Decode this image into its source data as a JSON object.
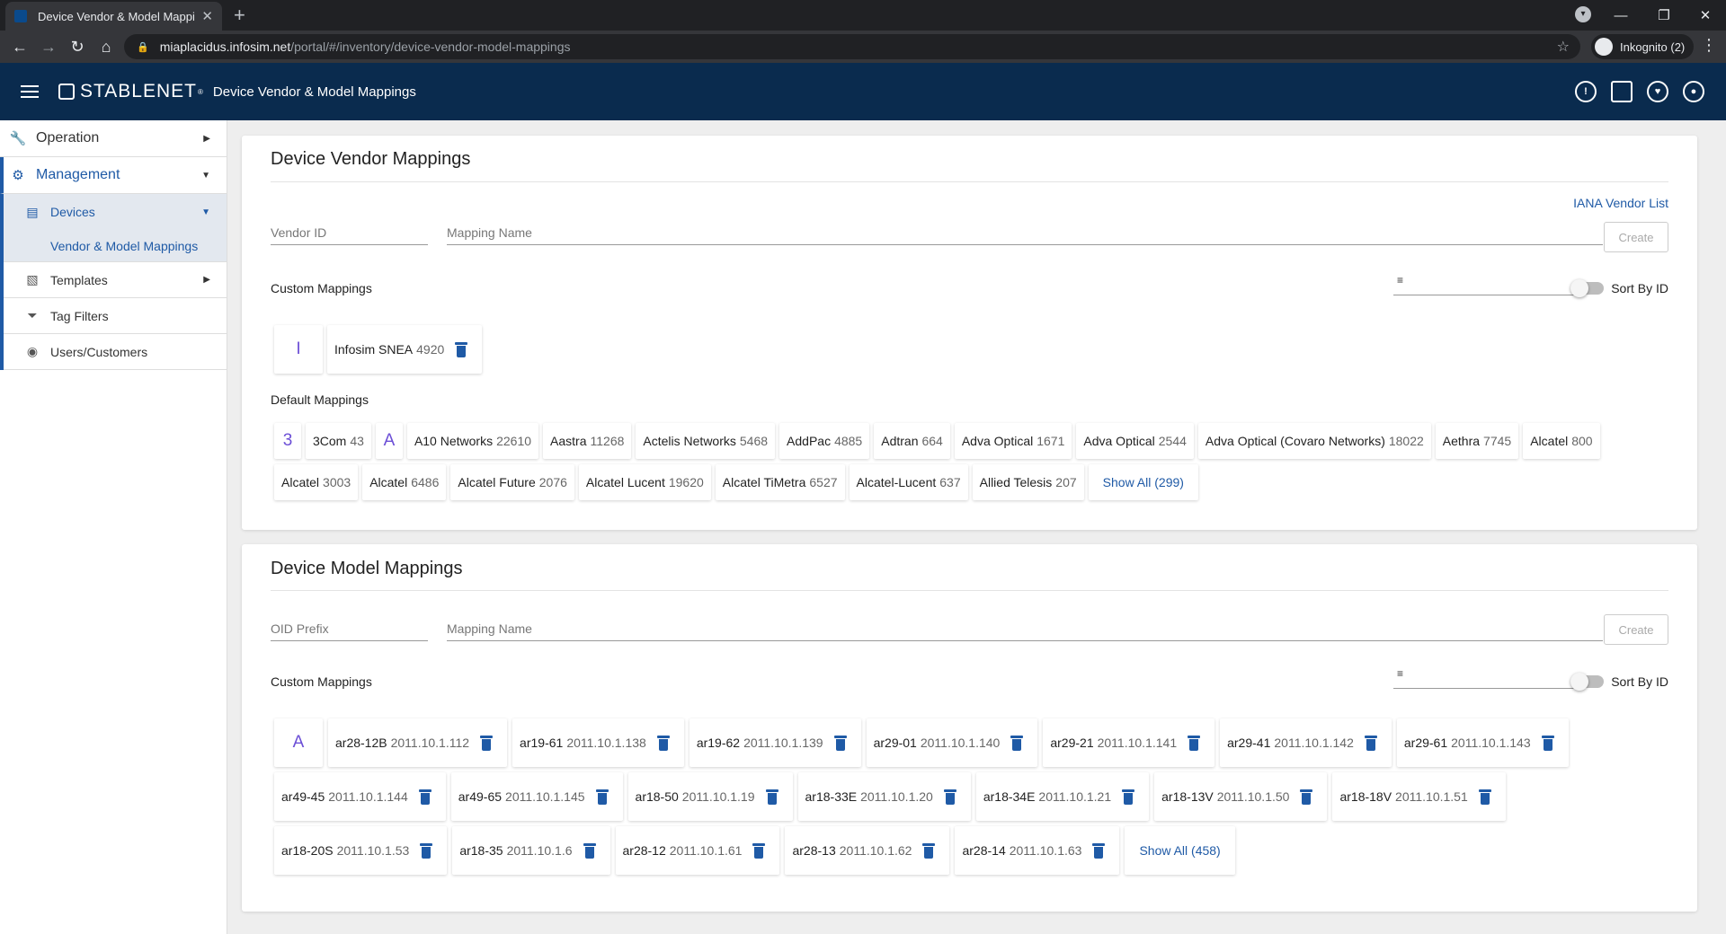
{
  "browser": {
    "tab_title": "Device Vendor & Model Mappings",
    "url_host": "miaplacidus.infosim.net",
    "url_path": "/portal/#/inventory/device-vendor-model-mappings",
    "profile": "Inkognito (2)"
  },
  "header": {
    "brand": "STABLENET",
    "brand_mark": "®",
    "title": "Device Vendor & Model Mappings",
    "icons": [
      "info-icon",
      "bookmark-icon",
      "heart-pulse-icon",
      "account-icon"
    ]
  },
  "sidebar": {
    "operation": "Operation",
    "management": "Management",
    "devices": "Devices",
    "vendor_model": "Vendor & Model Mappings",
    "templates": "Templates",
    "tag_filters": "Tag Filters",
    "users": "Users/Customers"
  },
  "vendor": {
    "title": "Device Vendor Mappings",
    "iana_link": "IANA Vendor List",
    "vendor_id_placeholder": "Vendor ID",
    "mapping_name_placeholder": "Mapping Name",
    "create": "Create",
    "custom_label": "Custom Mappings",
    "sort_label": "Sort By ID",
    "default_label": "Default Mappings",
    "custom_letter": "I",
    "custom": [
      {
        "name": "Infosim SNEA",
        "id": "4920"
      }
    ],
    "default_row1": [
      {
        "letter": "3"
      },
      {
        "name": "3Com",
        "id": "43"
      },
      {
        "letter": "A"
      },
      {
        "name": "A10 Networks",
        "id": "22610"
      },
      {
        "name": "Aastra",
        "id": "11268"
      },
      {
        "name": "Actelis Networks",
        "id": "5468"
      },
      {
        "name": "AddPac",
        "id": "4885"
      },
      {
        "name": "Adtran",
        "id": "664"
      },
      {
        "name": "Adva Optical",
        "id": "1671"
      },
      {
        "name": "Adva Optical",
        "id": "2544"
      },
      {
        "name": "Adva Optical (Covaro Networks)",
        "id": "18022"
      },
      {
        "name": "Aethra",
        "id": "7745"
      },
      {
        "name": "Alcatel",
        "id": "800"
      },
      {
        "name": "Alcatel",
        "id": "3003"
      }
    ],
    "default_row2": [
      {
        "name": "Alcatel",
        "id": "6486"
      },
      {
        "name": "Alcatel Future",
        "id": "2076"
      },
      {
        "name": "Alcatel Lucent",
        "id": "19620"
      },
      {
        "name": "Alcatel TiMetra",
        "id": "6527"
      },
      {
        "name": "Alcatel-Lucent",
        "id": "637"
      },
      {
        "name": "Allied Telesis",
        "id": "207"
      }
    ],
    "show_all": "Show All (299)"
  },
  "model": {
    "title": "Device Model Mappings",
    "oid_placeholder": "OID Prefix",
    "mapping_name_placeholder": "Mapping Name",
    "create": "Create",
    "custom_label": "Custom Mappings",
    "sort_label": "Sort By ID",
    "letter": "A",
    "items": [
      {
        "name": "ar28-12B",
        "id": "2011.10.1.112"
      },
      {
        "name": "ar19-61",
        "id": "2011.10.1.138"
      },
      {
        "name": "ar19-62",
        "id": "2011.10.1.139"
      },
      {
        "name": "ar29-01",
        "id": "2011.10.1.140"
      },
      {
        "name": "ar29-21",
        "id": "2011.10.1.141"
      },
      {
        "name": "ar29-41",
        "id": "2011.10.1.142"
      },
      {
        "name": "ar29-61",
        "id": "2011.10.1.143"
      },
      {
        "name": "ar49-45",
        "id": "2011.10.1.144"
      },
      {
        "name": "ar49-65",
        "id": "2011.10.1.145"
      },
      {
        "name": "ar18-50",
        "id": "2011.10.1.19"
      },
      {
        "name": "ar18-33E",
        "id": "2011.10.1.20"
      },
      {
        "name": "ar18-34E",
        "id": "2011.10.1.21"
      },
      {
        "name": "ar18-13V",
        "id": "2011.10.1.50"
      },
      {
        "name": "ar18-18V",
        "id": "2011.10.1.51"
      },
      {
        "name": "ar18-20S",
        "id": "2011.10.1.53"
      },
      {
        "name": "ar18-35",
        "id": "2011.10.1.6"
      },
      {
        "name": "ar28-12",
        "id": "2011.10.1.61"
      },
      {
        "name": "ar28-13",
        "id": "2011.10.1.62"
      },
      {
        "name": "ar28-14",
        "id": "2011.10.1.63"
      }
    ],
    "show_all": "Show All (458)"
  }
}
